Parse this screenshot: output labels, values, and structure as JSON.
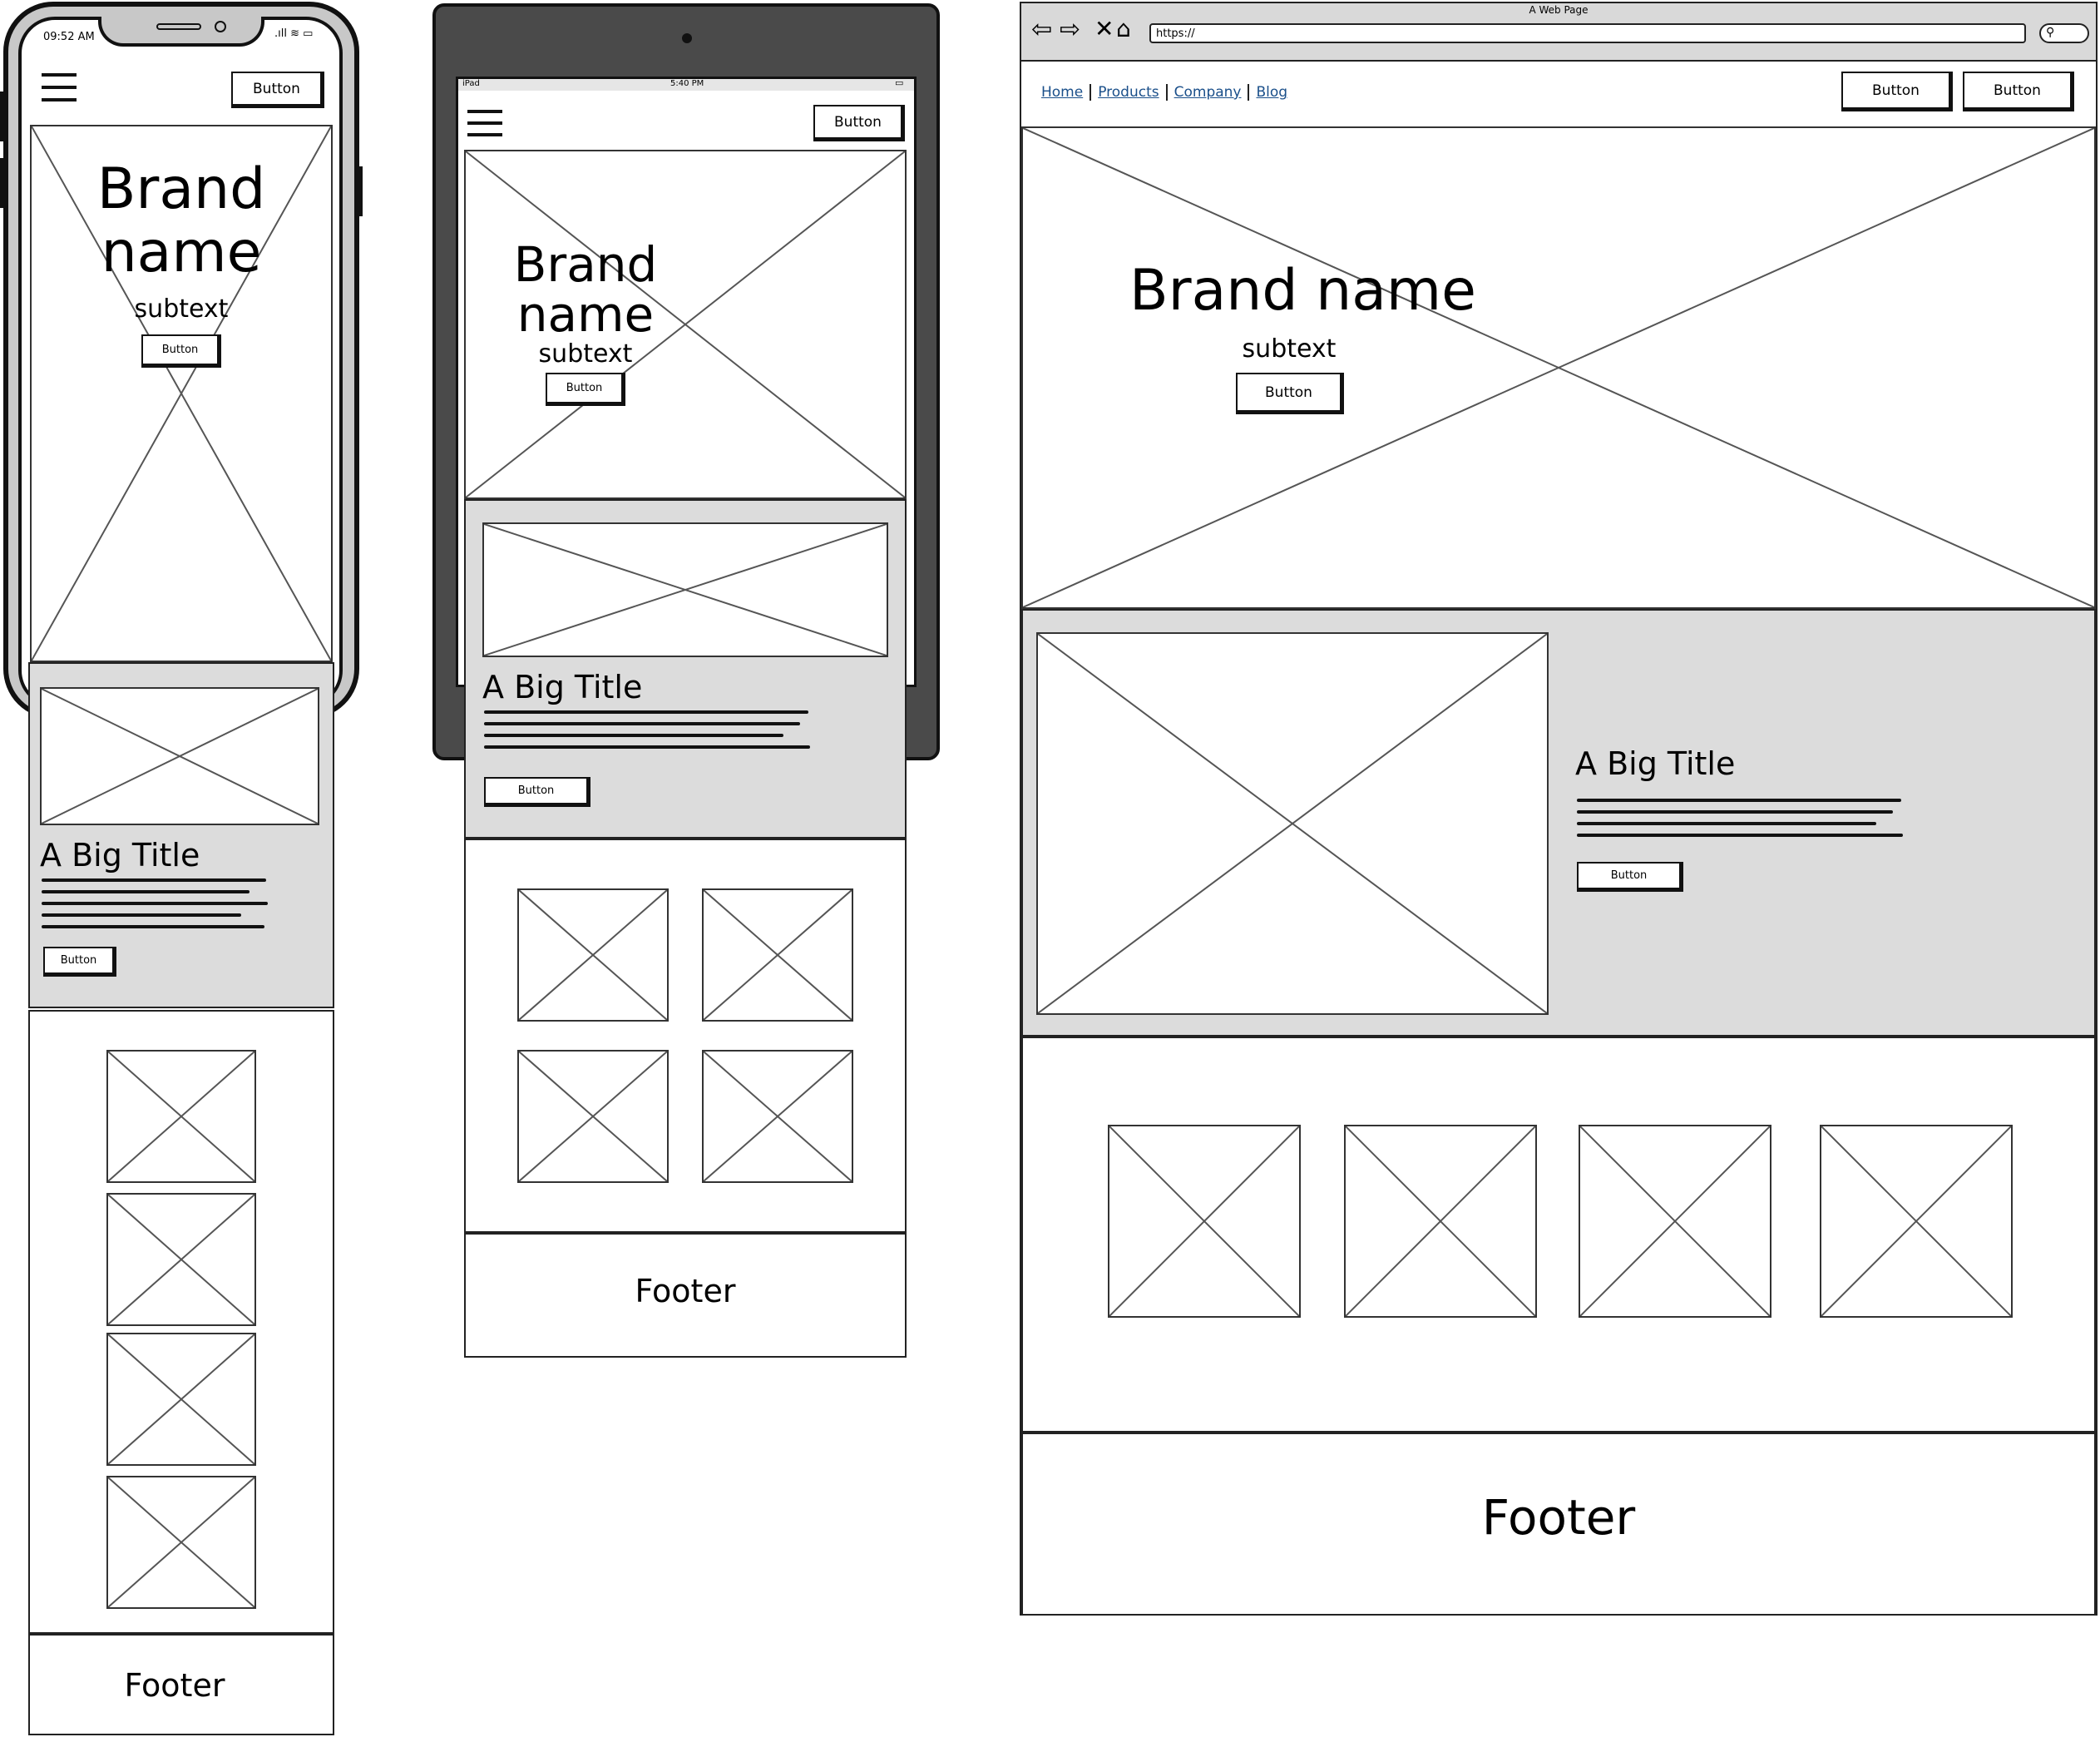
{
  "phone": {
    "status_time": "09:52 AM",
    "header_button": "Button",
    "hero": {
      "title": "Brand name",
      "subtext": "subtext",
      "button": "Button"
    },
    "feature": {
      "title": "A Big Title",
      "button": "Button"
    },
    "footer": "Footer"
  },
  "tablet": {
    "status_left": "iPad",
    "status_time": "5:40 PM",
    "header_button": "Button",
    "hero": {
      "title": "Brand name",
      "subtext": "subtext",
      "button": "Button"
    },
    "feature": {
      "title": "A Big Title",
      "button": "Button"
    },
    "footer": "Footer"
  },
  "desktop": {
    "window_title": "A Web Page",
    "url": "https://",
    "nav": [
      "Home",
      "Products",
      "Company",
      "Blog"
    ],
    "header_buttons": [
      "Button",
      "Button"
    ],
    "hero": {
      "title": "Brand name",
      "subtext": "subtext",
      "button": "Button"
    },
    "feature": {
      "title": "A Big Title",
      "button": "Button"
    },
    "footer": "Footer"
  }
}
